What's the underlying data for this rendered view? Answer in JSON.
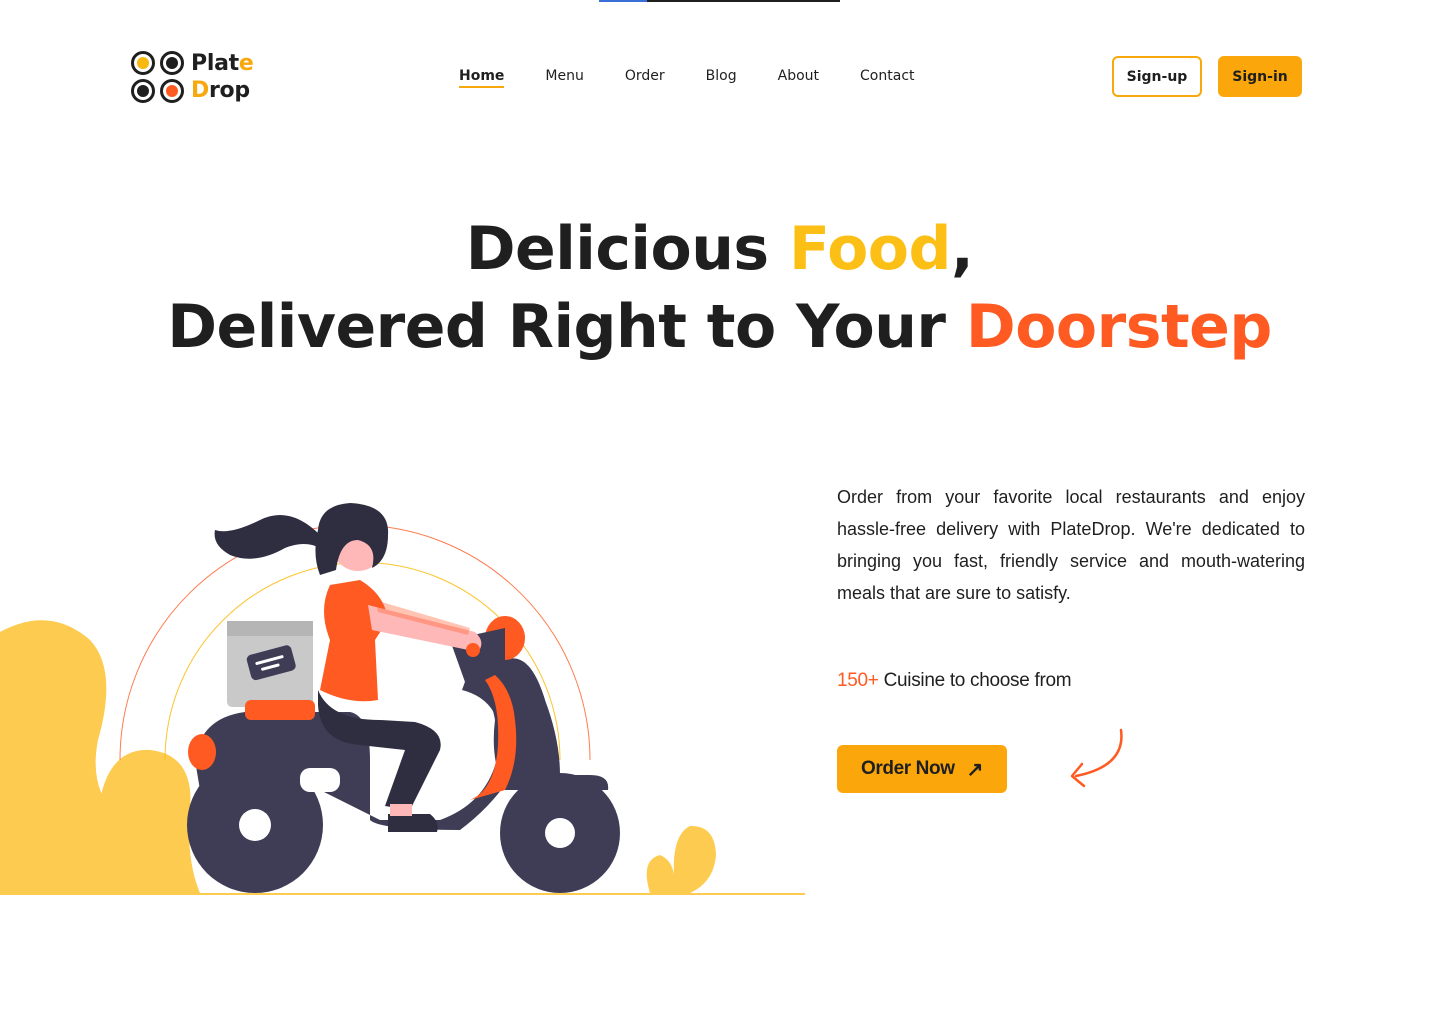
{
  "brand": {
    "line1": "Plat",
    "line1_accent": "e",
    "line2_accent": "D",
    "line2": "rop",
    "dots": [
      "#f7b90f",
      "#1f1f1f",
      "#1f1f1f",
      "#ff5a22"
    ]
  },
  "nav": {
    "items": [
      {
        "label": "Home",
        "active": true
      },
      {
        "label": "Menu"
      },
      {
        "label": "Order"
      },
      {
        "label": "Blog"
      },
      {
        "label": "About"
      },
      {
        "label": "Contact"
      }
    ]
  },
  "auth": {
    "signup_label": "Sign-up",
    "signin_label": "Sign-in"
  },
  "hero": {
    "line1_part1": "Delicious ",
    "line1_accent": "Food",
    "line1_part2": ",",
    "line2_part1": "Delivered Right to Your ",
    "line2_accent": "Doorstep"
  },
  "content": {
    "description": "Order from your favorite local restaurants and enjoy hassle-free delivery with PlateDrop. We're dedicated to bringing you fast, friendly service and mouth-watering meals that are sure to satisfy.",
    "stat_number": "150+",
    "stat_text": " Cuisine to choose from",
    "order_button_label": "Order Now",
    "order_button_icon": "arrow-up-right-icon"
  },
  "colors": {
    "accent_yellow": "#fba70b",
    "food_yellow": "#fbbf16",
    "accent_orange": "#ff5a22",
    "dark": "#1f1f1f",
    "scooter": "#3f3d56",
    "bush": "#fccb4f"
  }
}
